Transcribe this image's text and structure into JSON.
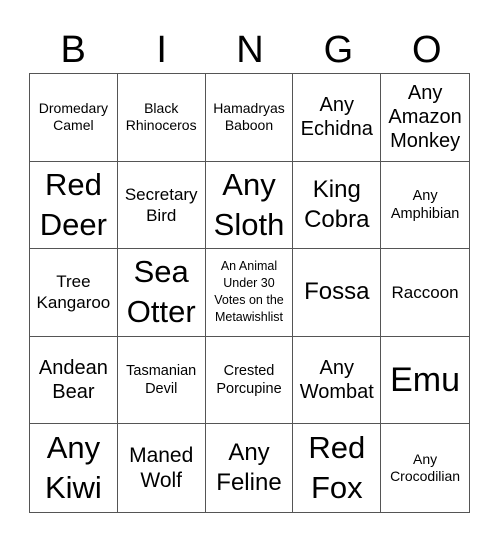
{
  "header": {
    "letters": [
      "B",
      "I",
      "N",
      "G",
      "O"
    ]
  },
  "card": {
    "rows": [
      [
        "Dromedary Camel",
        "Black Rhinoceros",
        "Hamadryas Baboon",
        "Any Echidna",
        "Any Amazon Monkey"
      ],
      [
        "Red Deer",
        "Secretary Bird",
        "Any Sloth",
        "King Cobra",
        "Any Amphibian"
      ],
      [
        "Tree Kangaroo",
        "Sea Otter",
        "An Animal Under 30 Votes on the Metawishlist",
        "Fossa",
        "Raccoon"
      ],
      [
        "Andean Bear",
        "Tasmanian Devil",
        "Crested Porcupine",
        "Any Wombat",
        "Emu"
      ],
      [
        "Any Kiwi",
        "Maned Wolf",
        "Any Feline",
        "Red Fox",
        "Any Crocodilian"
      ]
    ]
  }
}
